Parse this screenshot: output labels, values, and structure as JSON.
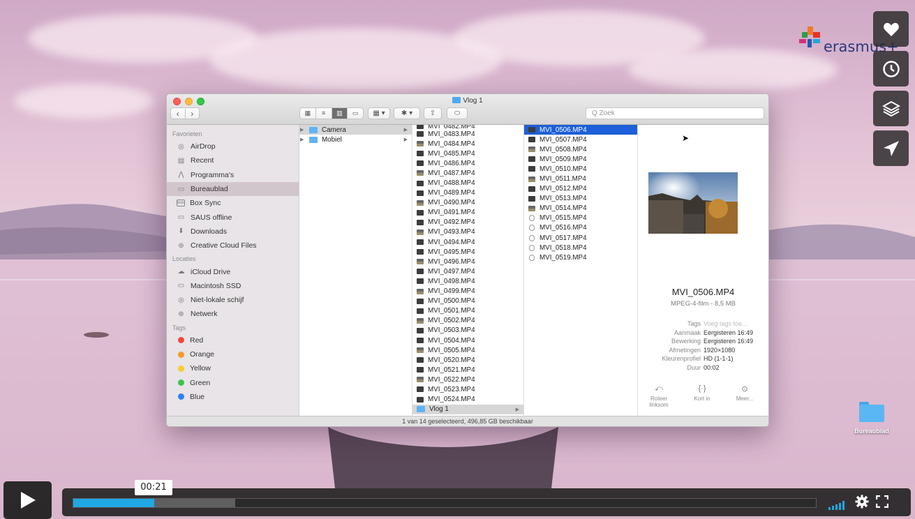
{
  "finder": {
    "window_title": "Vlog 1",
    "search_placeholder": "Q Zoek",
    "status": "1 van 14 geselecteerd, 496,85 GB beschikbaar",
    "sidebar": {
      "favorites_header": "Favorieten",
      "favorites": [
        {
          "label": "AirDrop",
          "icon": "airdrop-icon"
        },
        {
          "label": "Recent",
          "icon": "recent-icon"
        },
        {
          "label": "Programma's",
          "icon": "applications-icon"
        },
        {
          "label": "Bureaublad",
          "icon": "desktop-icon",
          "selected": true
        },
        {
          "label": "Box Sync",
          "icon": "box-icon"
        },
        {
          "label": "SAUS offline",
          "icon": "folder-icon"
        },
        {
          "label": "Downloads",
          "icon": "downloads-icon"
        },
        {
          "label": "Creative Cloud Files",
          "icon": "creative-cloud-icon"
        }
      ],
      "locations_header": "Locaties",
      "locations": [
        {
          "label": "iCloud Drive",
          "icon": "icloud-icon"
        },
        {
          "label": "Macintosh SSD",
          "icon": "disk-icon"
        },
        {
          "label": "Niet-lokale schijf",
          "icon": "optical-disk-icon"
        },
        {
          "label": "Netwerk",
          "icon": "network-icon"
        }
      ],
      "tags_header": "Tags",
      "tags": [
        {
          "label": "Red",
          "color": "#f0473d"
        },
        {
          "label": "Orange",
          "color": "#f69a2a"
        },
        {
          "label": "Yellow",
          "color": "#f7cd2f"
        },
        {
          "label": "Green",
          "color": "#3ec24c"
        },
        {
          "label": "Blue",
          "color": "#2f7ff2"
        }
      ]
    },
    "col1": [
      {
        "label": "Camera",
        "selected": true
      },
      {
        "label": "Mobiel"
      }
    ],
    "col2_top_partial": "MVI_0482.MP4",
    "col2": [
      "MVI_0483.MP4",
      "MVI_0484.MP4",
      "MVI_0485.MP4",
      "MVI_0486.MP4",
      "MVI_0487.MP4",
      "MVI_0488.MP4",
      "MVI_0489.MP4",
      "MVI_0490.MP4",
      "MVI_0491.MP4",
      "MVI_0492.MP4",
      "MVI_0493.MP4",
      "MVI_0494.MP4",
      "MVI_0495.MP4",
      "MVI_0496.MP4",
      "MVI_0497.MP4",
      "MVI_0498.MP4",
      "MVI_0499.MP4",
      "MVI_0500.MP4",
      "MVI_0501.MP4",
      "MVI_0502.MP4",
      "MVI_0503.MP4",
      "MVI_0504.MP4",
      "MVI_0505.MP4",
      "MVI_0520.MP4",
      "MVI_0521.MP4",
      "MVI_0522.MP4",
      "MVI_0523.MP4",
      "MVI_0524.MP4"
    ],
    "col2_folder": "Vlog 1",
    "col3": [
      "MVI_0506.MP4",
      "MVI_0507.MP4",
      "MVI_0508.MP4",
      "MVI_0509.MP4",
      "MVI_0510.MP4",
      "MVI_0511.MP4",
      "MVI_0512.MP4",
      "MVI_0513.MP4",
      "MVI_0514.MP4",
      "MVI_0515.MP4",
      "MVI_0516.MP4",
      "MVI_0517.MP4",
      "MVI_0518.MP4",
      "MVI_0519.MP4"
    ],
    "preview": {
      "name": "MVI_0506.MP4",
      "kind": "MPEG-4-film - 8,5 MB",
      "meta": [
        {
          "key": "Tags",
          "value": "Voeg tags toe...",
          "placeholder": true
        },
        {
          "key": "Aanmaak",
          "value": "Eergisteren 16:49"
        },
        {
          "key": "Bewerking",
          "value": "Eergisteren 16:49"
        },
        {
          "key": "Afmetingen",
          "value": "1920×1080"
        },
        {
          "key": "Kleurenprofiel",
          "value": "HD (1-1-1)"
        },
        {
          "key": "Duur",
          "value": "00:02"
        }
      ],
      "actions": [
        {
          "label": "Roteer linksom",
          "icon": "rotate-left-icon"
        },
        {
          "label": "Kort in",
          "icon": "trim-icon"
        },
        {
          "label": "Meer...",
          "icon": "more-icon"
        }
      ]
    }
  },
  "desktop": {
    "logo_text": "erasmus+",
    "folder_label": "Bureaublad"
  },
  "player": {
    "time_tooltip": "00:21",
    "played_fraction": 0.109,
    "loaded_fraction": 0.218,
    "accent": "#1fa8e3",
    "side_buttons": [
      "heart-icon",
      "clock-icon",
      "layers-icon",
      "send-icon"
    ]
  }
}
